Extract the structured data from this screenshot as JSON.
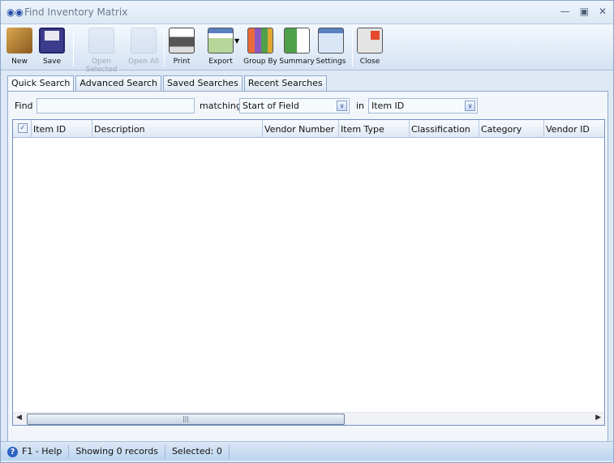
{
  "window": {
    "title": "Find Inventory Matrix",
    "icon": "binoculars-icon"
  },
  "toolbar": [
    {
      "label": "New",
      "icon": "new-box-icon",
      "enabled": true
    },
    {
      "label": "Save",
      "icon": "floppy-disk-icon",
      "enabled": true
    },
    {
      "label": "Open Selected",
      "icon": "open-selected-icon",
      "enabled": false
    },
    {
      "label": "Open All",
      "icon": "open-all-icon",
      "enabled": false
    },
    {
      "label": "Print",
      "icon": "printer-icon",
      "enabled": true
    },
    {
      "label": "Export",
      "icon": "export-icon",
      "enabled": true
    },
    {
      "label": "Group By",
      "icon": "group-by-icon",
      "enabled": true
    },
    {
      "label": "Summary",
      "icon": "summary-icon",
      "enabled": true
    },
    {
      "label": "Settings",
      "icon": "settings-icon",
      "enabled": true
    },
    {
      "label": "Close",
      "icon": "close-window-icon",
      "enabled": true
    }
  ],
  "tabs": [
    "Quick Search",
    "Advanced Search",
    "Saved Searches",
    "Recent Searches"
  ],
  "search": {
    "find_label": "Find",
    "find_value": "",
    "matching_label": "matching",
    "matching_value": "Start of Field",
    "in_label": "in",
    "in_value": "Item ID"
  },
  "grid": {
    "columns": [
      "Item ID",
      "Description",
      "Vendor Number",
      "Item Type",
      "Classification",
      "Category",
      "Vendor ID"
    ],
    "rows": []
  },
  "status": {
    "help": "F1 - Help",
    "records": "Showing 0 records",
    "selected": "Selected: 0"
  }
}
